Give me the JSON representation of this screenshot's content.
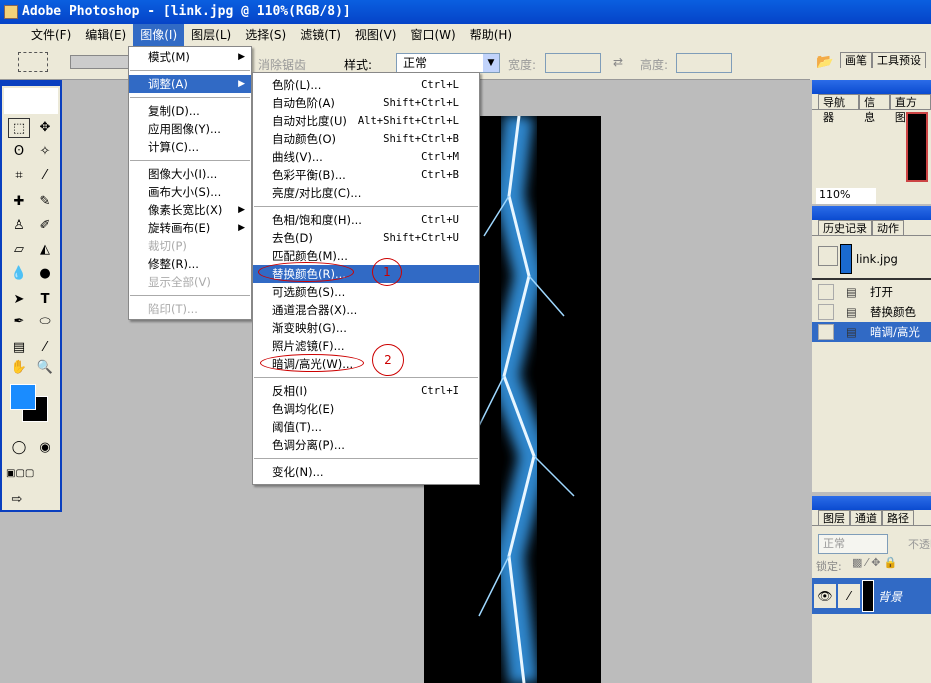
{
  "window": {
    "title": "Adobe Photoshop - [link.jpg @ 110%(RGB/8)]"
  },
  "menubar": [
    "文件(F)",
    "编辑(E)",
    "图像(I)",
    "图层(L)",
    "选择(S)",
    "滤镜(T)",
    "视图(V)",
    "窗口(W)",
    "帮助(H)"
  ],
  "options": {
    "antialias": "消除锯齿",
    "style_label": "样式:",
    "style_value": "正常",
    "width_label": "宽度:",
    "height_label": "高度:"
  },
  "image_menu": [
    {
      "label": "模式(M)",
      "submenu": true
    },
    {
      "sep": true
    },
    {
      "label": "调整(A)",
      "submenu": true,
      "highlighted": true
    },
    {
      "sep": true
    },
    {
      "label": "复制(D)..."
    },
    {
      "label": "应用图像(Y)..."
    },
    {
      "label": "计算(C)..."
    },
    {
      "sep": true
    },
    {
      "label": "图像大小(I)..."
    },
    {
      "label": "画布大小(S)..."
    },
    {
      "label": "像素长宽比(X)",
      "submenu": true
    },
    {
      "label": "旋转画布(E)",
      "submenu": true
    },
    {
      "label": "裁切(P)",
      "disabled": true
    },
    {
      "label": "修整(R)..."
    },
    {
      "label": "显示全部(V)",
      "disabled": true
    },
    {
      "sep": true
    },
    {
      "label": "陷印(T)...",
      "disabled": true
    }
  ],
  "adjust_menu": [
    {
      "label": "色阶(L)...",
      "shortcut": "Ctrl+L"
    },
    {
      "label": "自动色阶(A)",
      "shortcut": "Shift+Ctrl+L"
    },
    {
      "label": "自动对比度(U)",
      "shortcut": "Alt+Shift+Ctrl+L"
    },
    {
      "label": "自动颜色(O)",
      "shortcut": "Shift+Ctrl+B"
    },
    {
      "label": "曲线(V)...",
      "shortcut": "Ctrl+M"
    },
    {
      "label": "色彩平衡(B)...",
      "shortcut": "Ctrl+B"
    },
    {
      "label": "亮度/对比度(C)..."
    },
    {
      "sep": true
    },
    {
      "label": "色相/饱和度(H)...",
      "shortcut": "Ctrl+U"
    },
    {
      "label": "去色(D)",
      "shortcut": "Shift+Ctrl+U"
    },
    {
      "label": "匹配颜色(M)..."
    },
    {
      "label": "替换颜色(R)...",
      "highlighted": true
    },
    {
      "label": "可选颜色(S)..."
    },
    {
      "label": "通道混合器(X)..."
    },
    {
      "label": "渐变映射(G)..."
    },
    {
      "label": "照片滤镜(F)..."
    },
    {
      "label": "暗调/高光(W)..."
    },
    {
      "sep": true
    },
    {
      "label": "反相(I)",
      "shortcut": "Ctrl+I"
    },
    {
      "label": "色调均化(E)"
    },
    {
      "label": "阈值(T)..."
    },
    {
      "label": "色调分离(P)..."
    },
    {
      "sep": true
    },
    {
      "label": "变化(N)..."
    }
  ],
  "annotations": [
    "1",
    "2"
  ],
  "panels": {
    "top_tabs": [
      "画笔",
      "工具预设"
    ],
    "navigator_tabs": [
      "导航器",
      "信息",
      "直方图"
    ],
    "zoom": "110%",
    "history_tabs": [
      "历史记录",
      "动作"
    ],
    "history_snapshot": "link.jpg",
    "history_items": [
      {
        "label": "打开"
      },
      {
        "label": "替换颜色"
      },
      {
        "label": "暗调/高光",
        "active": true
      }
    ],
    "layers_tabs": [
      "图层",
      "通道",
      "路径"
    ],
    "blend_mode": "正常",
    "opacity_label": "不透明度",
    "lock_label": "锁定:",
    "layer_name": "背景"
  },
  "colors": {
    "accent": "#316ac5",
    "foreground": "#1a8cff",
    "background": "#000000"
  }
}
